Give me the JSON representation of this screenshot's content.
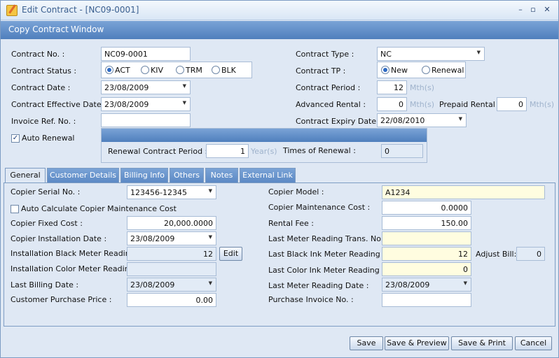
{
  "window": {
    "title": "Edit Contract - [NC09-0001]",
    "min": "–",
    "restore": "▫",
    "close": "✕"
  },
  "menu": {
    "copy_contract": "Copy Contract",
    "window": "Window"
  },
  "contract": {
    "no_label": "Contract No. :",
    "no_value": "NC09-0001",
    "status_label": "Contract Status :",
    "status_options": [
      "ACT",
      "KIV",
      "TRM",
      "BLK"
    ],
    "date_label": "Contract Date :",
    "date_value": "23/08/2009",
    "eff_date_label": "Contract Effective Date :",
    "eff_date_value": "23/08/2009",
    "invoice_label": "Invoice Ref. No. :",
    "invoice_value": "",
    "auto_renewal_label": "Auto Renewal",
    "type_label": "Contract Type :",
    "type_value": "NC",
    "tp_label": "Contract TP :",
    "tp_options": [
      "New",
      "Renewal"
    ],
    "period_label": "Contract Period :",
    "period_value": "12",
    "period_unit": "Mth(s)",
    "adv_rental_label": "Advanced Rental :",
    "adv_rental_value": "0",
    "adv_rental_unit": "Mth(s)",
    "prepaid_label": "Prepaid Rental :",
    "prepaid_value": "0",
    "prepaid_unit": "Mth(s)",
    "expiry_label": "Contract Expiry Date :",
    "expiry_value": "22/08/2010"
  },
  "renewal": {
    "period_label": "Renewal Contract Period :",
    "period_value": "1",
    "period_unit": "Year(s)",
    "times_label": "Times of Renewal :",
    "times_value": "0"
  },
  "tabs": [
    "General",
    "Customer Details",
    "Billing Info",
    "Others",
    "Notes",
    "External Link"
  ],
  "general": {
    "serial_label": "Copier Serial No. :",
    "serial_value": "123456-12345",
    "auto_calc_label": "Auto Calculate Copier Maintenance Cost",
    "fixed_cost_label": "Copier Fixed Cost :",
    "fixed_cost_value": "20,000.0000",
    "install_date_label": "Copier Installation Date :",
    "install_date_value": "23/08/2009",
    "install_black_label": "Installation Black Meter Reading",
    "install_black_value": "12",
    "edit_label": "Edit",
    "install_color_label": "Installation Color Meter Reading",
    "install_color_value": "",
    "last_billing_label": "Last Billing Date :",
    "last_billing_value": "23/08/2009",
    "purchase_price_label": "Customer Purchase Price :",
    "purchase_price_value": "0.00",
    "model_label": "Copier Model :",
    "model_value": "A1234",
    "maint_cost_label": "Copier Maintenance Cost :",
    "maint_cost_value": "0.0000",
    "rental_fee_label": "Rental Fee :",
    "rental_fee_value": "150.00",
    "last_meter_trans_label": "Last Meter Reading Trans. No. :",
    "last_meter_trans_value": "",
    "last_black_label": "Last Black Ink Meter Reading :",
    "last_black_value": "12",
    "adjust_bill_label": "Adjust  Bill:",
    "adjust_bill_value": "0",
    "last_color_label": "Last Color Ink Meter Reading :",
    "last_color_value": "0",
    "last_meter_date_label": "Last Meter Reading Date :",
    "last_meter_date_value": "23/08/2009",
    "purchase_invoice_label": "Purchase Invoice No. :",
    "purchase_invoice_value": ""
  },
  "buttons": {
    "save": "Save",
    "save_preview": "Save & Preview",
    "save_print": "Save & Print",
    "cancel": "Cancel"
  },
  "colors": {
    "header_blue": "#4f7fbd",
    "panel": "#dfe8f4",
    "highlight": "#fffde0"
  }
}
